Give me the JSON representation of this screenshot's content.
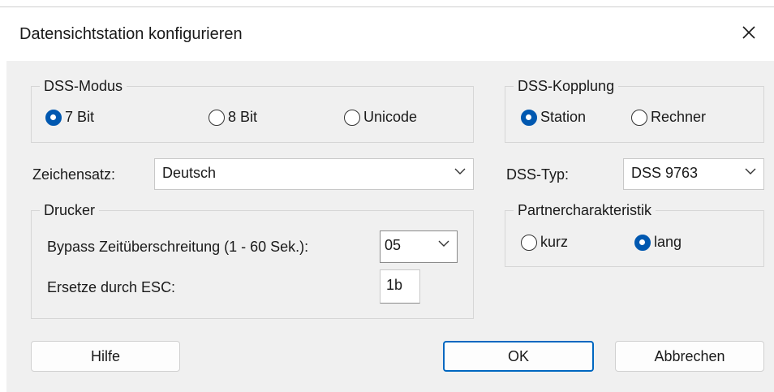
{
  "window": {
    "title": "Datensichtstation konfigurieren",
    "close_glyph": "✕"
  },
  "dss_modus": {
    "legend": "DSS-Modus",
    "options": [
      {
        "label": "7 Bit",
        "checked": true
      },
      {
        "label": "8 Bit",
        "checked": false
      },
      {
        "label": "Unicode",
        "checked": false
      }
    ]
  },
  "dss_kopplung": {
    "legend": "DSS-Kopplung",
    "options": [
      {
        "label": "Station",
        "checked": true
      },
      {
        "label": "Rechner",
        "checked": false
      }
    ]
  },
  "zeichensatz": {
    "label": "Zeichensatz:",
    "value": "Deutsch"
  },
  "dss_typ": {
    "label": "DSS-Typ:",
    "value": "DSS 9763"
  },
  "drucker": {
    "legend": "Drucker",
    "bypass_label": "Bypass Zeitüberschreitung (1 - 60 Sek.):",
    "bypass_value": "05",
    "esc_label": "Ersetze durch ESC:",
    "esc_value": "1b"
  },
  "partner": {
    "legend": "Partnercharakteristik",
    "options": [
      {
        "label": "kurz",
        "checked": false
      },
      {
        "label": "lang",
        "checked": true
      }
    ]
  },
  "buttons": {
    "help": "Hilfe",
    "ok": "OK",
    "cancel": "Abbrechen"
  },
  "colors": {
    "accent": "#0058b0",
    "dialog_bg": "#f0f0f0"
  }
}
